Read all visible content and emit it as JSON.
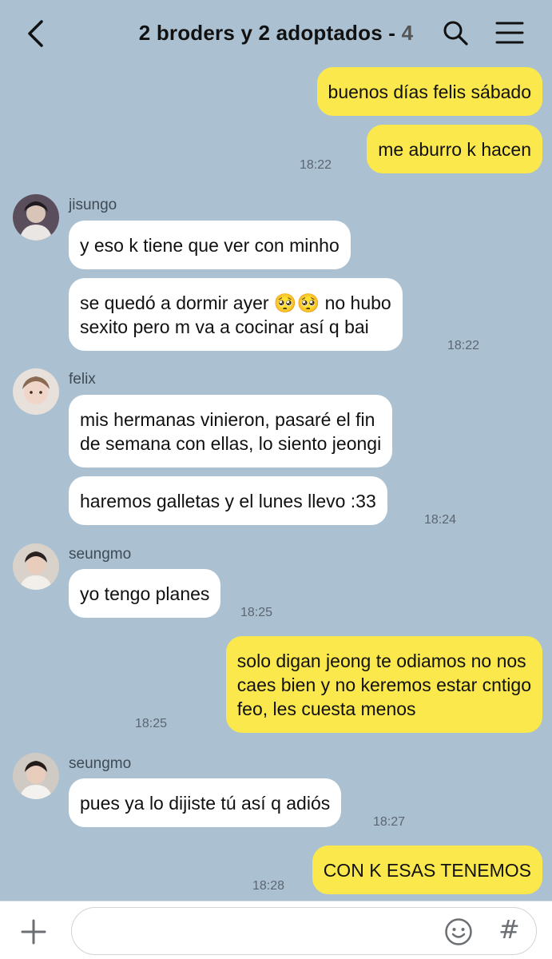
{
  "header": {
    "title": "2 broders y 2 adoptados - ",
    "member_count": "4"
  },
  "messages": [
    {
      "text": "buenos días felis sábado"
    },
    {
      "text": "me aburro k hacen",
      "time": "18:22"
    },
    {
      "sender": "jisungo",
      "text": "y eso k tiene que ver con minho"
    },
    {
      "text": "se quedó a dormir ayer 🥺🥺 no hubo\nsexito pero m va a cocinar así q bai",
      "time": "18:22"
    },
    {
      "sender": "felix",
      "text": "mis hermanas vinieron, pasaré el fin\nde semana con ellas, lo siento jeongi"
    },
    {
      "text": "haremos galletas y el lunes llevo :33",
      "time": "18:24"
    },
    {
      "sender": "seungmo",
      "text": "yo tengo planes",
      "time": "18:25"
    },
    {
      "text": "solo digan jeong te odiamos no nos\ncaes bien y no keremos estar cntigo\nfeo, les cuesta menos",
      "time": "18:25"
    },
    {
      "sender": "seungmo",
      "text": "pues ya lo dijiste tú así q adiós",
      "time": "18:27"
    },
    {
      "text": "CON K ESAS TENEMOS",
      "time": "18:28"
    }
  ],
  "composer": {
    "value": "",
    "placeholder": ""
  },
  "colors": {
    "background": "#abc1d1",
    "my_bubble": "#fae84c",
    "their_bubble": "#ffffff"
  },
  "icons": [
    "back-arrow-icon",
    "search-icon",
    "menu-icon",
    "plus-icon",
    "emoji-icon",
    "hashtag-icon"
  ]
}
